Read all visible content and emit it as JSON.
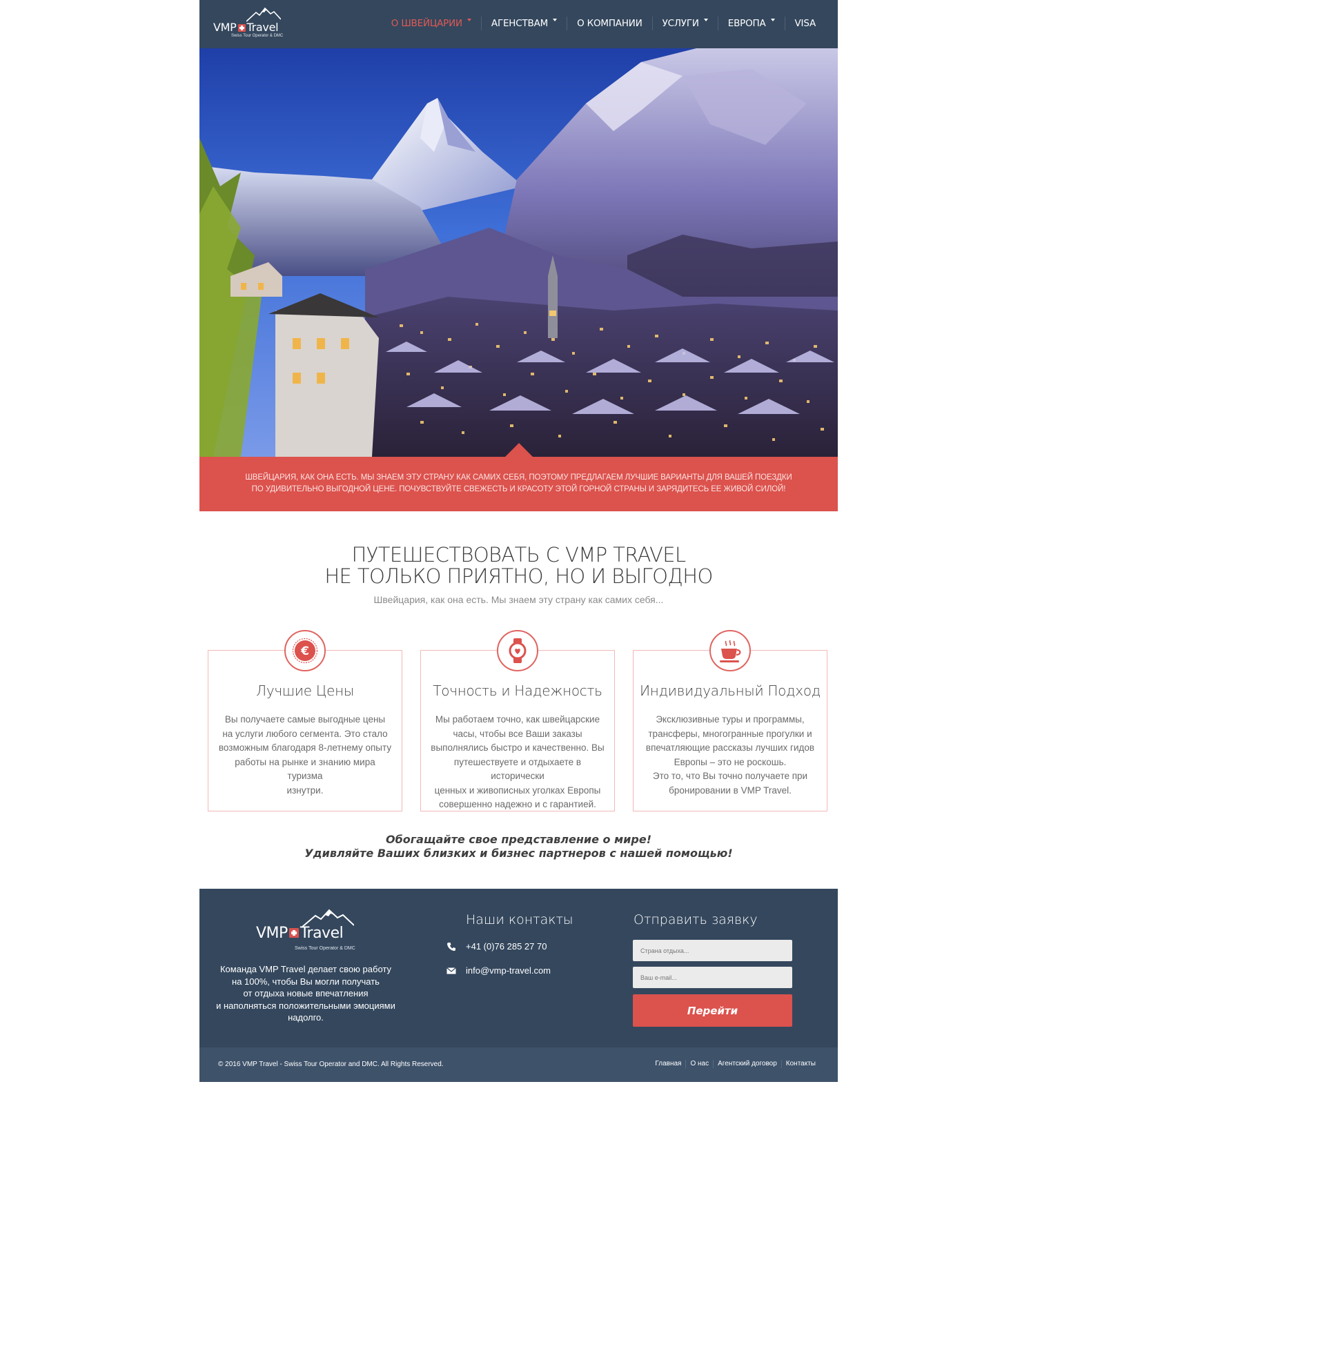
{
  "brand": {
    "name_left": "VMP",
    "name_right": "Travel",
    "tagline": "Swiss Tour Operator & DMC"
  },
  "nav": {
    "items": [
      {
        "label": "О ШВЕЙЦАРИИ",
        "dropdown": true,
        "active": true
      },
      {
        "label": "АГЕНСТВАМ",
        "dropdown": true,
        "active": false
      },
      {
        "label": "О КОМПАНИИ",
        "dropdown": false,
        "active": false
      },
      {
        "label": "УСЛУГИ",
        "dropdown": true,
        "active": false
      },
      {
        "label": "ЕВРОПА",
        "dropdown": true,
        "active": false
      },
      {
        "label": "VISA",
        "dropdown": false,
        "active": false
      }
    ]
  },
  "banner": {
    "text_line1": "Швейцария, как она есть. Мы знаем эту страну как самих себя, поэтому предлагаем лучшие варианты для вашей поездки",
    "text_line2": "по удивительно выгодной цене. Почувствуйте свежесть и красоту этой горной страны и зарядитесь ее живой силой!"
  },
  "intro": {
    "title_line1": "ПУТЕШЕСТВОВАТЬ С VMP TRAVEL",
    "title_line2": "НЕ ТОЛЬКО ПРИЯТНО, НО И ВЫГОДНО",
    "subtitle": "Швейцария, как она есть. Мы знаем эту страну как самих себя..."
  },
  "features": [
    {
      "icon": "euro-icon",
      "title": "Лучшие Цены",
      "text": "Вы получаете самые выгодные цены\nна услуги любого сегмента. Это стало\nвозможным благодаря 8-летнему опыту\nработы на рынке и знанию мира туризма\nизнутри."
    },
    {
      "icon": "watch-icon",
      "title": "Точность и Надежность",
      "text": "Мы работаем точно, как швейцарские\nчасы, чтобы все Ваши заказы\nвыполнялись быстро и качественно. Вы\nпутешествуете и отдыхаете в исторически\nценных и живописных уголках Европы\nсовершенно надежно и с гарантией."
    },
    {
      "icon": "coffee-cup-icon",
      "title": "Индивидуальный Подход",
      "text": "Эксклюзивные туры и программы,\nтрансферы, многогранные прогулки и\nвпечатляющие рассказы лучших гидов\nЕвропы – это не роскошь.\nЭто то, что Вы точно получаете при\nбронировании в VMP Travel."
    }
  ],
  "slogan": "Обогащайте свое представление о мире!\nУдивляйте Ваших близких и бизнес партнеров с нашей помощью!",
  "footer": {
    "about": "Команда VMP Travel делает свою работу\nна 100%, чтобы Вы могли получать\nот отдыха новые впечатления\nи наполняться положительными эмоциями\nнадолго.",
    "contacts_title": "Наши контакты",
    "phone": "+41 (0)76 285 27 70",
    "email": "info@vmp-travel.com",
    "form_title": "Отправить заявку",
    "country_placeholder": "Страна отдыха...",
    "email_placeholder": "Ваш e-mail...",
    "submit_label": "Перейти",
    "copyright": "© 2016 VMP Travel - Swiss Tour Operator and DMC. All Rights Reserved.",
    "links": [
      "Главная",
      "О нас",
      "Агентский договор",
      "Контакты"
    ]
  },
  "colors": {
    "header_bg": "#34475d",
    "accent": "#dc524d",
    "bottom_bar": "#3e526a"
  }
}
